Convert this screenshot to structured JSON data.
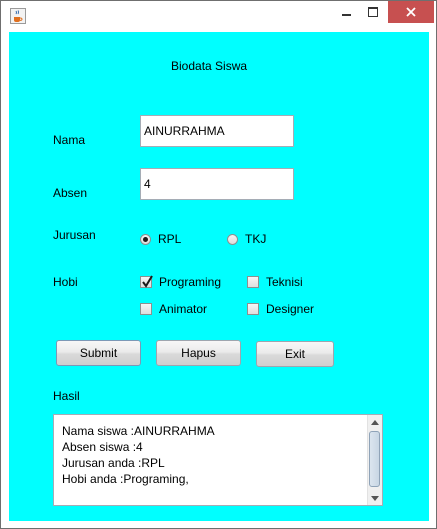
{
  "form": {
    "title": "Biodata Siswa",
    "nama_label": "Nama",
    "nama_value": "AINURRAHMA",
    "absen_label": "Absen",
    "absen_value": "4",
    "jurusan_label": "Jurusan",
    "jurusan_options": [
      {
        "label": "RPL",
        "selected": true
      },
      {
        "label": "TKJ",
        "selected": false
      }
    ],
    "hobi_label": "Hobi",
    "hobi_options": [
      {
        "label": "Programing",
        "checked": true
      },
      {
        "label": "Teknisi",
        "checked": false
      },
      {
        "label": "Animator",
        "checked": false
      },
      {
        "label": "Designer",
        "checked": false
      }
    ],
    "buttons": {
      "submit": "Submit",
      "hapus": "Hapus",
      "exit": "Exit"
    },
    "hasil_label": "Hasil",
    "hasil_lines": [
      "Nama siswa :AINURRAHMA",
      "Absen siswa :4",
      "Jurusan anda :RPL",
      "Hobi anda :Programing,"
    ]
  },
  "colors": {
    "panel_background": "#00ffff",
    "close_button": "#c75050"
  },
  "icons": {
    "app": "java-coffee-icon",
    "minimize": "minimize-icon",
    "maximize": "maximize-icon",
    "close": "close-icon",
    "scroll_up": "arrow-up-icon",
    "scroll_down": "arrow-down-icon"
  }
}
